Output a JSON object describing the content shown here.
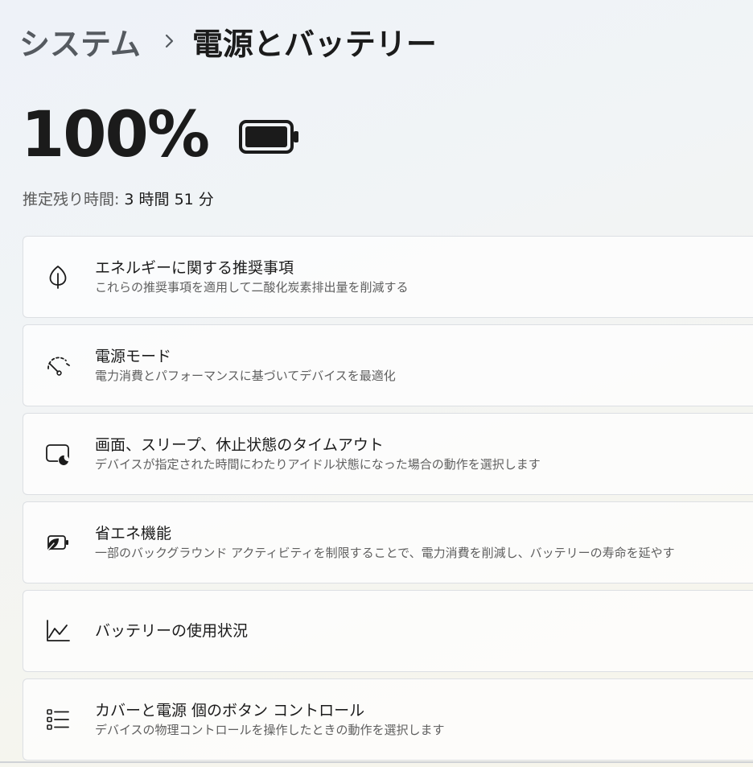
{
  "breadcrumb": {
    "parent": "システム",
    "current": "電源とバッテリー"
  },
  "battery": {
    "percent": "100%",
    "level": 1.0,
    "estimate_label": "推定残り時間:",
    "estimate_value": "3 時間 51 分"
  },
  "cards": [
    {
      "icon": "leaf-icon",
      "title": "エネルギーに関する推奨事項",
      "desc": "これらの推奨事項を適用して二酸化炭素排出量を削減する"
    },
    {
      "icon": "gauge-icon",
      "title": "電源モード",
      "desc": "電力消費とパフォーマンスに基づいてデバイスを最適化"
    },
    {
      "icon": "screen-sleep-icon",
      "title": "画面、スリープ、休止状態のタイムアウト",
      "desc": "デバイスが指定された時間にわたりアイドル状態になった場合の動作を選択します"
    },
    {
      "icon": "battery-saver-icon",
      "title": "省エネ機能",
      "desc": "一部のバックグラウンド アクティビティを制限することで、電力消費を削減し、バッテリーの寿命を延やす"
    },
    {
      "icon": "chart-line-icon",
      "title": "バッテリーの使用状況",
      "desc": ""
    },
    {
      "icon": "list-icon",
      "title": "カバーと電源 個のボタン コントロール",
      "desc": "デバイスの物理コントロールを操作したときの動作を選択します"
    }
  ]
}
